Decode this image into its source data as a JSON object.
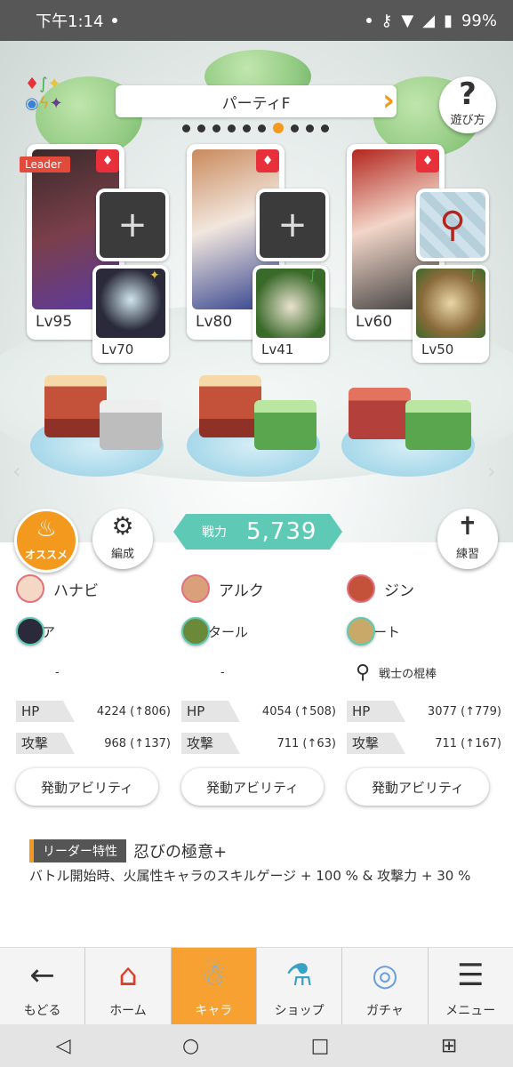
{
  "status": {
    "time": "下午1:14",
    "battery": "99%"
  },
  "party": {
    "title": "パーティF",
    "dots_count": 9,
    "active_dot": 8
  },
  "help": {
    "label": "遊び方"
  },
  "cards": [
    {
      "leader": "Leader",
      "lv": "Lv95",
      "sub_lv": "Lv70"
    },
    {
      "lv": "Lv80",
      "sub_lv": "Lv41"
    },
    {
      "lv": "Lv60",
      "sub_lv": "Lv50"
    }
  ],
  "buttons": {
    "recommend": "オススメ",
    "formation": "編成",
    "practice": "練習"
  },
  "power": {
    "label": "戦力",
    "value": "5,739"
  },
  "members": [
    {
      "name": "ハナビ",
      "sub": "ディア",
      "equip": "-",
      "hp_label": "HP",
      "hp": "4224 (↑806)",
      "atk_label": "攻撃",
      "atk": "968 (↑137)",
      "ability": "発動アビリティ"
    },
    {
      "name": "アルク",
      "sub": "レシタール",
      "equip": "-",
      "hp_label": "HP",
      "hp": "4054 (↑508)",
      "atk_label": "攻撃",
      "atk": "711 (↑63)",
      "ability": "発動アビリティ"
    },
    {
      "name": "ジン",
      "sub": "ボジート",
      "equip": "戦士の棍棒",
      "hp_label": "HP",
      "hp": "3077 (↑779)",
      "atk_label": "攻撃",
      "atk": "711 (↑167)",
      "ability": "発動アビリティ"
    }
  ],
  "leader_trait": {
    "tag": "リーダー特性",
    "name": "忍びの極意+",
    "description": "バトル開始時、火属性キャラのスキルゲージ + 100 % & 攻撃力 + 30 %"
  },
  "menu": {
    "items": [
      {
        "label": "もどる",
        "icon": "back-arrow-icon"
      },
      {
        "label": "ホーム",
        "icon": "home-icon"
      },
      {
        "label": "キャラ",
        "icon": "character-icon",
        "active": true
      },
      {
        "label": "ショップ",
        "icon": "shop-icon"
      },
      {
        "label": "ガチャ",
        "icon": "gacha-icon"
      },
      {
        "label": "メニュー",
        "icon": "menu-icon"
      }
    ]
  },
  "colors": {
    "accent": "#f39a1e",
    "power": "#5ecab6",
    "fire": "#e8303b"
  }
}
